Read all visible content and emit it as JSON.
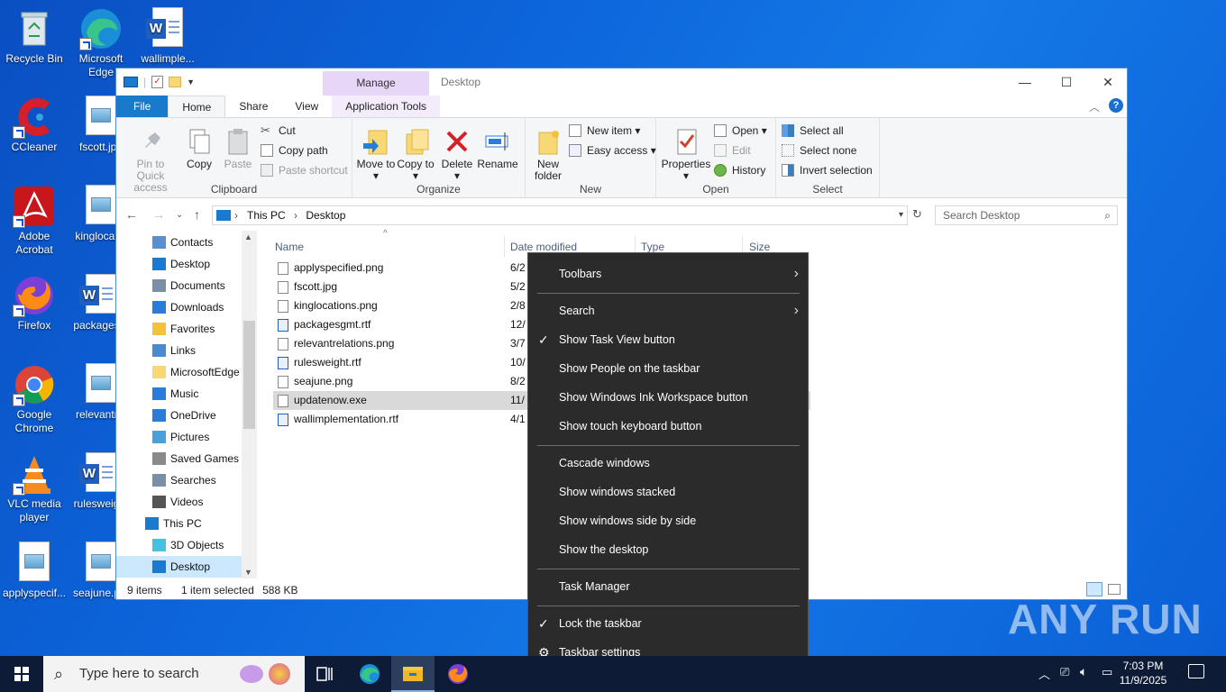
{
  "desktop": {
    "icons": [
      {
        "label": "Recycle Bin",
        "icon": "recycle-bin-icon"
      },
      {
        "label": "Microsoft Edge",
        "icon": "edge-icon"
      },
      {
        "label": "wallimple...",
        "icon": "word-document-icon"
      },
      {
        "label": "CCleaner",
        "icon": "ccleaner-icon"
      },
      {
        "label": "fscott.jpg",
        "icon": "image-file-icon"
      },
      {
        "label": "Adobe Acrobat",
        "icon": "acrobat-icon"
      },
      {
        "label": "kinglocat...",
        "icon": "image-file-icon"
      },
      {
        "label": "Firefox",
        "icon": "firefox-icon"
      },
      {
        "label": "packages...",
        "icon": "word-document-icon"
      },
      {
        "label": "Google Chrome",
        "icon": "chrome-icon"
      },
      {
        "label": "relevantr...",
        "icon": "image-file-icon"
      },
      {
        "label": "VLC media player",
        "icon": "vlc-icon"
      },
      {
        "label": "rulesweig...",
        "icon": "word-document-icon"
      },
      {
        "label": "applyspecif...",
        "icon": "image-file-icon"
      },
      {
        "label": "seajune.p...",
        "icon": "image-file-icon"
      }
    ]
  },
  "explorer": {
    "title": "Desktop",
    "context_tab": "Manage",
    "tabs": {
      "file": "File",
      "home": "Home",
      "share": "Share",
      "view": "View",
      "apptools": "Application Tools"
    },
    "ribbon": {
      "clipboard": {
        "label": "Clipboard",
        "pin": "Pin to Quick access",
        "copy": "Copy",
        "paste": "Paste",
        "cut": "Cut",
        "copy_path": "Copy path",
        "paste_shortcut": "Paste shortcut"
      },
      "organize": {
        "label": "Organize",
        "move_to": "Move to",
        "copy_to": "Copy to",
        "delete": "Delete",
        "rename": "Rename"
      },
      "new": {
        "label": "New",
        "new_folder": "New folder",
        "new_item": "New item",
        "easy_access": "Easy access"
      },
      "open": {
        "label": "Open",
        "properties": "Properties",
        "open": "Open",
        "edit": "Edit",
        "history": "History"
      },
      "select": {
        "label": "Select",
        "select_all": "Select all",
        "select_none": "Select none",
        "invert": "Invert selection"
      }
    },
    "address": {
      "this_pc": "This PC",
      "current": "Desktop"
    },
    "search_placeholder": "Search Desktop",
    "nav": [
      {
        "label": "Contacts",
        "icon": "contacts-icon"
      },
      {
        "label": "Desktop",
        "icon": "desktop-icon"
      },
      {
        "label": "Documents",
        "icon": "documents-icon"
      },
      {
        "label": "Downloads",
        "icon": "downloads-icon"
      },
      {
        "label": "Favorites",
        "icon": "favorites-icon"
      },
      {
        "label": "Links",
        "icon": "links-icon"
      },
      {
        "label": "MicrosoftEdge",
        "icon": "folder-icon"
      },
      {
        "label": "Music",
        "icon": "music-icon"
      },
      {
        "label": "OneDrive",
        "icon": "onedrive-icon"
      },
      {
        "label": "Pictures",
        "icon": "pictures-icon"
      },
      {
        "label": "Saved Games",
        "icon": "saved-games-icon"
      },
      {
        "label": "Searches",
        "icon": "searches-icon"
      },
      {
        "label": "Videos",
        "icon": "videos-icon"
      },
      {
        "label": "This PC",
        "icon": "this-pc-icon"
      },
      {
        "label": "3D Objects",
        "icon": "3d-objects-icon"
      },
      {
        "label": "Desktop",
        "icon": "desktop-icon"
      }
    ],
    "columns": {
      "name": "Name",
      "date": "Date modified",
      "type": "Type",
      "size": "Size"
    },
    "files": [
      {
        "name": "applyspecified.png",
        "date": "6/2"
      },
      {
        "name": "fscott.jpg",
        "date": "5/2"
      },
      {
        "name": "kinglocations.png",
        "date": "2/8"
      },
      {
        "name": "packagesgmt.rtf",
        "date": "12/"
      },
      {
        "name": "relevantrelations.png",
        "date": "3/7"
      },
      {
        "name": "rulesweight.rtf",
        "date": "10/"
      },
      {
        "name": "seajune.png",
        "date": "8/2"
      },
      {
        "name": "updatenow.exe",
        "date": "11/"
      },
      {
        "name": "wallimplementation.rtf",
        "date": "4/1"
      }
    ],
    "status": {
      "count": "9 items",
      "selected": "1 item selected",
      "size": "588 KB"
    }
  },
  "context_menu": {
    "items": [
      {
        "label": "Toolbars"
      },
      {
        "label": "Search"
      },
      {
        "label": "Show Task View button"
      },
      {
        "label": "Show People on the taskbar"
      },
      {
        "label": "Show Windows Ink Workspace button"
      },
      {
        "label": "Show touch keyboard button"
      },
      {
        "label": "Cascade windows"
      },
      {
        "label": "Show windows stacked"
      },
      {
        "label": "Show windows side by side"
      },
      {
        "label": "Show the desktop"
      },
      {
        "label": "Task Manager"
      },
      {
        "label": "Lock the taskbar"
      },
      {
        "label": "Taskbar settings"
      }
    ]
  },
  "taskbar": {
    "search_placeholder": "Type here to search",
    "time": "7:03 PM",
    "date": "11/9/2025"
  },
  "watermark": "ANY RUN"
}
